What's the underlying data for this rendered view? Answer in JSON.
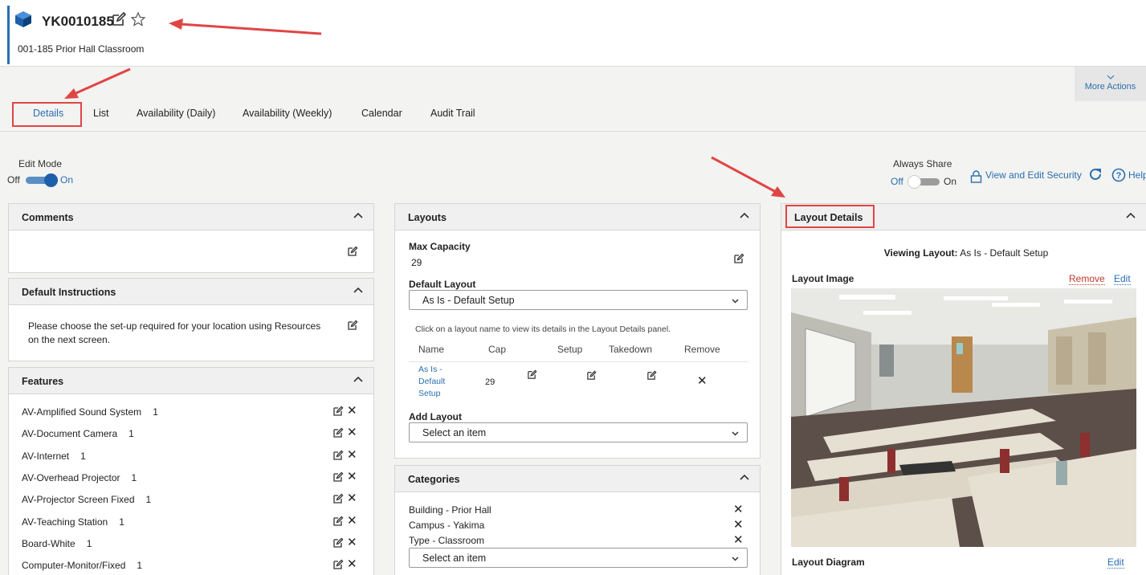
{
  "header": {
    "resource_id": "YK0010185",
    "subtitle": "001-185 Prior Hall Classroom",
    "more_actions": "More Actions"
  },
  "tabs": [
    {
      "label": "Details",
      "active": true
    },
    {
      "label": "List"
    },
    {
      "label": "Availability (Daily)"
    },
    {
      "label": "Availability (Weekly)"
    },
    {
      "label": "Calendar"
    },
    {
      "label": "Audit Trail"
    }
  ],
  "edit_mode": {
    "label": "Edit Mode",
    "off": "Off",
    "on": "On",
    "value": "on"
  },
  "always_share": {
    "label": "Always Share",
    "off": "Off",
    "on": "On",
    "value": "off"
  },
  "toolbar": {
    "security": "View and Edit Security",
    "help": "Help"
  },
  "comments": {
    "title": "Comments"
  },
  "default_instructions": {
    "title": "Default Instructions",
    "text": "Please choose the set-up required for your location using Resources on the next screen."
  },
  "features": {
    "title": "Features",
    "items": [
      {
        "name": "AV-Amplified Sound System",
        "count": "1"
      },
      {
        "name": "AV-Document Camera",
        "count": "1"
      },
      {
        "name": "AV-Internet",
        "count": "1"
      },
      {
        "name": "AV-Overhead Projector",
        "count": "1"
      },
      {
        "name": "AV-Projector Screen Fixed",
        "count": "1"
      },
      {
        "name": "AV-Teaching Station",
        "count": "1"
      },
      {
        "name": "Board-White",
        "count": "1"
      },
      {
        "name": "Computer-Monitor/Fixed",
        "count": "1"
      }
    ]
  },
  "layouts": {
    "title": "Layouts",
    "max_capacity_label": "Max Capacity",
    "max_capacity": "29",
    "default_layout_label": "Default Layout",
    "default_layout": "As Is - Default Setup",
    "hint": "Click on a layout name to view its details in the Layout Details panel.",
    "columns": [
      "Name",
      "Cap",
      "Setup",
      "Takedown",
      "Remove"
    ],
    "rows": [
      {
        "name_lines": [
          "As Is -",
          "Default",
          "Setup"
        ],
        "cap": "29"
      }
    ],
    "add_layout_label": "Add Layout",
    "add_placeholder": "Select an item"
  },
  "categories": {
    "title": "Categories",
    "items": [
      "Building - Prior Hall",
      "Campus - Yakima",
      "Type - Classroom"
    ],
    "placeholder": "Select an item"
  },
  "layout_details": {
    "title": "Layout Details",
    "viewing_label": "Viewing Layout:",
    "viewing_value": "As Is - Default Setup",
    "image_label": "Layout Image",
    "remove": "Remove",
    "edit": "Edit",
    "diagram_label": "Layout Diagram",
    "diagram_edit": "Edit"
  },
  "colors": {
    "accent": "#2a6fb0",
    "annotation": "#e04545",
    "remove": "#c0392b"
  }
}
